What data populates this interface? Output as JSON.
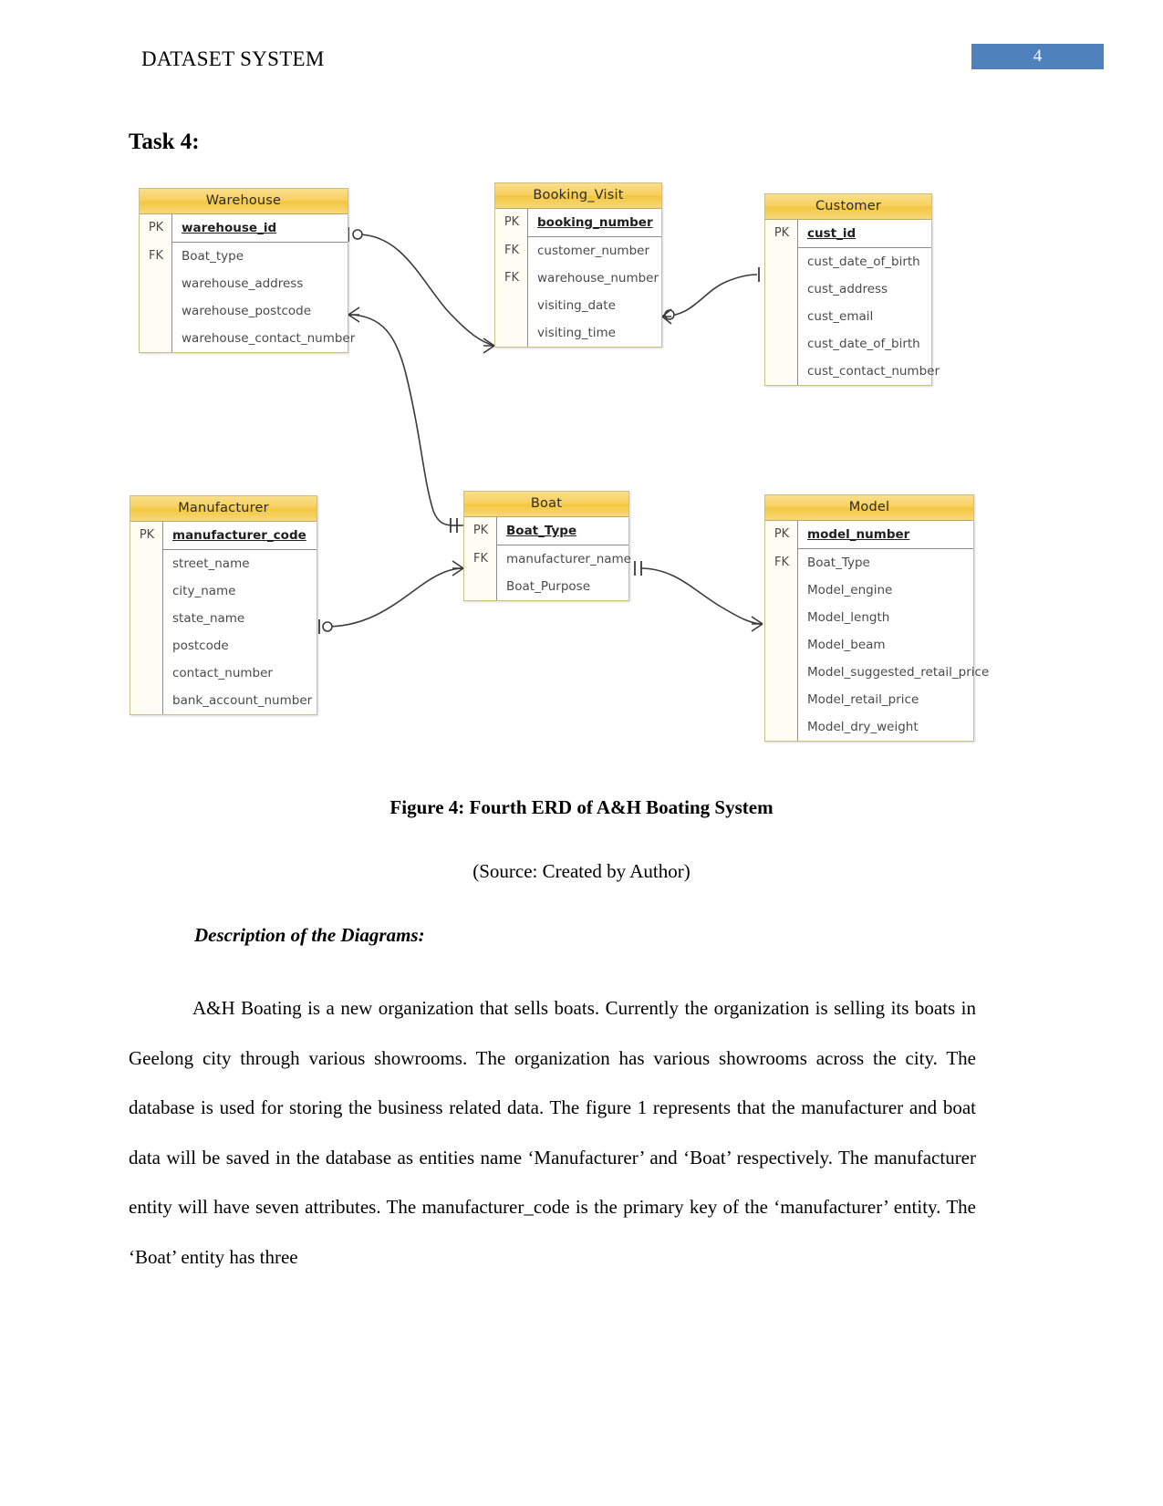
{
  "header": {
    "document_title": "DATASET SYSTEM",
    "page_number": "4"
  },
  "task": {
    "heading": "Task 4:"
  },
  "figure": {
    "caption": "Figure 4: Fourth ERD of A&H Boating System",
    "source": "(Source: Created by Author)"
  },
  "description": {
    "subheading": "Description of the Diagrams:",
    "paragraph": "A&H Boating is a new organization that sells boats. Currently the organization is selling its boats in Geelong city through various showrooms. The organization has various showrooms across the city. The database is used for storing the business related data. The figure 1 represents that the manufacturer and boat data will be saved in the database as entities name ‘Manufacturer’ and ‘Boat’ respectively. The manufacturer entity will have seven attributes. The manufacturer_code is the primary key of the ‘manufacturer’ entity. The ‘Boat’ entity has three"
  },
  "erd": {
    "colors": {
      "header_fill": "#f3c73f",
      "entity_border": "#c9c08a",
      "line": "#3a3a3a",
      "accent_blue": "#4f81bd"
    },
    "entities": [
      {
        "id": "warehouse",
        "name": "Warehouse",
        "pk_attributes": [
          {
            "key": "PK",
            "name": "warehouse_id"
          }
        ],
        "attributes": [
          {
            "key": "FK",
            "name": "Boat_type"
          },
          {
            "key": "",
            "name": "warehouse_address"
          },
          {
            "key": "",
            "name": "warehouse_postcode"
          },
          {
            "key": "",
            "name": "warehouse_contact_number"
          }
        ]
      },
      {
        "id": "booking_visit",
        "name": "Booking_Visit",
        "pk_attributes": [
          {
            "key": "PK",
            "name": "booking_number"
          }
        ],
        "attributes": [
          {
            "key": "FK",
            "name": "customer_number"
          },
          {
            "key": "FK",
            "name": "warehouse_number"
          },
          {
            "key": "",
            "name": "visiting_date"
          },
          {
            "key": "",
            "name": "visiting_time"
          }
        ]
      },
      {
        "id": "customer",
        "name": "Customer",
        "pk_attributes": [
          {
            "key": "PK",
            "name": "cust_id"
          }
        ],
        "attributes": [
          {
            "key": "",
            "name": "cust_date_of_birth"
          },
          {
            "key": "",
            "name": "cust_address"
          },
          {
            "key": "",
            "name": "cust_email"
          },
          {
            "key": "",
            "name": "cust_date_of_birth"
          },
          {
            "key": "",
            "name": "cust_contact_number"
          }
        ]
      },
      {
        "id": "manufacturer",
        "name": "Manufacturer",
        "pk_attributes": [
          {
            "key": "PK",
            "name": "manufacturer_code"
          }
        ],
        "attributes": [
          {
            "key": "",
            "name": "street_name"
          },
          {
            "key": "",
            "name": "city_name"
          },
          {
            "key": "",
            "name": "state_name"
          },
          {
            "key": "",
            "name": "postcode"
          },
          {
            "key": "",
            "name": "contact_number"
          },
          {
            "key": "",
            "name": "bank_account_number"
          }
        ]
      },
      {
        "id": "boat",
        "name": "Boat",
        "pk_attributes": [
          {
            "key": "PK",
            "name": "Boat_Type"
          }
        ],
        "attributes": [
          {
            "key": "FK",
            "name": "manufacturer_name"
          },
          {
            "key": "",
            "name": "Boat_Purpose"
          }
        ]
      },
      {
        "id": "model",
        "name": "Model",
        "pk_attributes": [
          {
            "key": "PK",
            "name": "model_number"
          }
        ],
        "attributes": [
          {
            "key": "FK",
            "name": "Boat_Type"
          },
          {
            "key": "",
            "name": "Model_engine"
          },
          {
            "key": "",
            "name": "Model_length"
          },
          {
            "key": "",
            "name": "Model_beam"
          },
          {
            "key": "",
            "name": "Model_suggested_retail_price"
          },
          {
            "key": "",
            "name": "Model_retail_price"
          },
          {
            "key": "",
            "name": "Model_dry_weight"
          }
        ]
      }
    ],
    "relationships": [
      {
        "from": "Warehouse",
        "to": "Booking_Visit",
        "from_cardinality": "one-optional",
        "to_cardinality": "many"
      },
      {
        "from": "Booking_Visit",
        "to": "Customer",
        "from_cardinality": "many-optional",
        "to_cardinality": "one"
      },
      {
        "from": "Warehouse",
        "to": "Boat",
        "from_cardinality": "many",
        "to_cardinality": "one-one"
      },
      {
        "from": "Manufacturer",
        "to": "Boat",
        "from_cardinality": "one-optional",
        "to_cardinality": "many"
      },
      {
        "from": "Boat",
        "to": "Model",
        "from_cardinality": "one-one",
        "to_cardinality": "many"
      }
    ]
  }
}
